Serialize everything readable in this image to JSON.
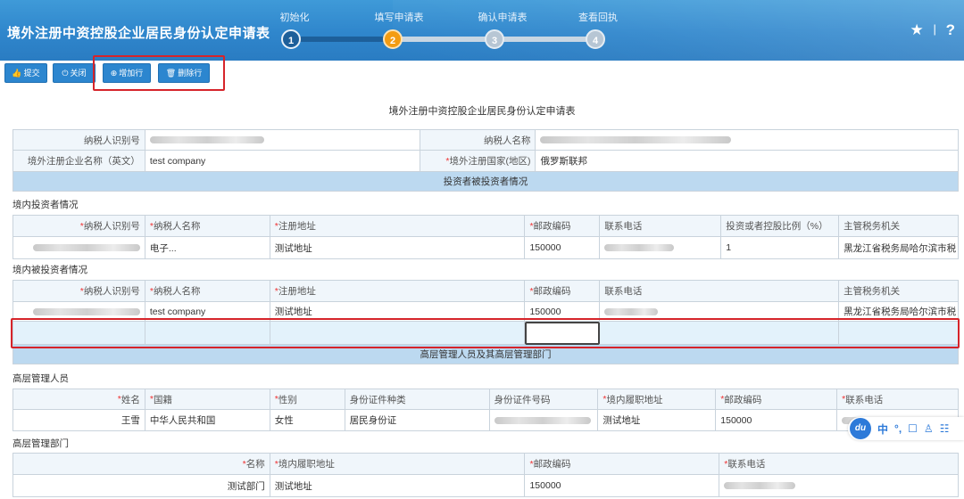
{
  "header": {
    "title": "境外注册中资控股企业居民身份认定申请表",
    "steps": [
      {
        "num": "1",
        "label": "初始化",
        "state": "done",
        "color": "#1d5f9a"
      },
      {
        "num": "2",
        "label": "填写申请表",
        "state": "current",
        "color": "#f39c12"
      },
      {
        "num": "3",
        "label": "确认申请表",
        "state": "todo",
        "color": "#c8d6e3"
      },
      {
        "num": "4",
        "label": "查看回执",
        "state": "todo",
        "color": "#c8d6e3"
      }
    ],
    "star_icon": "★",
    "help_icon": "?",
    "separator": "|"
  },
  "toolbar": {
    "submit": "提交",
    "close": "关闭",
    "add_row": "增加行",
    "delete_row": "删除行"
  },
  "form_title": "境外注册中资控股企业居民身份认定申请表",
  "basic": {
    "taxpayer_id_label": "纳税人识别号",
    "taxpayer_name_label": "纳税人名称",
    "company_en_label": "境外注册企业名称（英文）",
    "company_en_value": "test company",
    "country_label": "境外注册国家(地区)",
    "country_value": "俄罗斯联邦"
  },
  "investor_section": "投资者被投资者情况",
  "domestic_investor": {
    "title": "境内投资者情况",
    "headers": [
      "纳税人识别号",
      "纳税人名称",
      "注册地址",
      "邮政编码",
      "联系电话",
      "投资或者控股比例（%）",
      "主管税务机关"
    ],
    "row": {
      "name_prefix": "电子...",
      "address": "测试地址",
      "zip": "150000",
      "ratio": "1",
      "tax_office": "黑龙江省税务局哈尔滨市税"
    }
  },
  "domestic_investee": {
    "title": "境内被投资者情况",
    "headers": [
      "纳税人识别号",
      "纳税人名称",
      "注册地址",
      "邮政编码",
      "联系电话",
      "主管税务机关"
    ],
    "row": {
      "name": "test company",
      "address": "测试地址",
      "zip": "150000",
      "tax_office": "黑龙江省税务局哈尔滨市税"
    }
  },
  "mgmt_section": "高层管理人员及其高层管理部门",
  "managers": {
    "title": "高层管理人员",
    "headers": [
      "姓名",
      "国籍",
      "性别",
      "身份证件种类",
      "身份证件号码",
      "境内履职地址",
      "邮政编码",
      "联系电话"
    ],
    "row": {
      "name": "王雪",
      "nation": "中华人民共和国",
      "gender": "女性",
      "id_type": "居民身份证",
      "address": "测试地址",
      "zip": "150000"
    }
  },
  "departments": {
    "title": "高层管理部门",
    "headers": [
      "名称",
      "境内履职地址",
      "邮政编码",
      "联系电话"
    ],
    "row": {
      "name": "测试部门",
      "address": "测试地址",
      "zip": "150000"
    }
  },
  "ime": {
    "logo": "du",
    "items": [
      "中",
      "°,",
      "☐",
      "♙",
      "☷"
    ]
  }
}
